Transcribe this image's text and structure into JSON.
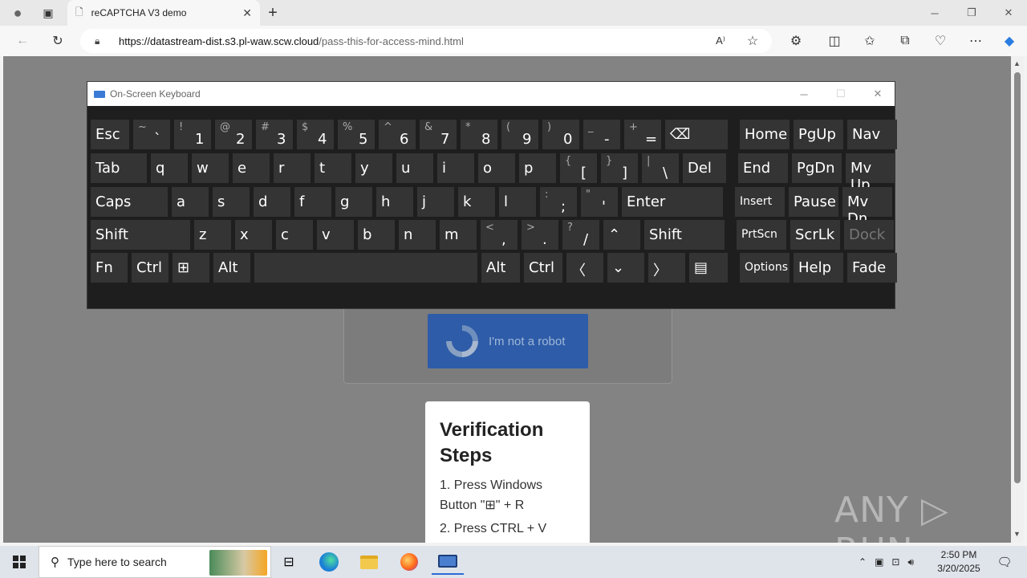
{
  "browser": {
    "tab_title": "reCAPTCHA V3 demo",
    "url_host": "https://datastream-dist.s3.pl-waw.scw.cloud",
    "url_path": "/pass-this-for-access-mind.html"
  },
  "page": {
    "captcha_label": "I'm not a robot",
    "steps_title": "Verification Steps",
    "step1": "1. Press Windows Button \"⊞\" + R",
    "step2": "2. Press CTRL + V",
    "watermark": "ANY ▷ RUN"
  },
  "osk": {
    "title": "On-Screen Keyboard",
    "rows": [
      [
        {
          "k": "esc",
          "main": "Esc"
        },
        {
          "k": "backtick",
          "shift": "~",
          "base": "`"
        },
        {
          "k": "1",
          "shift": "!",
          "base": "1"
        },
        {
          "k": "2",
          "shift": "@",
          "base": "2"
        },
        {
          "k": "3",
          "shift": "#",
          "base": "3"
        },
        {
          "k": "4",
          "shift": "$",
          "base": "4"
        },
        {
          "k": "5",
          "shift": "%",
          "base": "5"
        },
        {
          "k": "6",
          "shift": "^",
          "base": "6"
        },
        {
          "k": "7",
          "shift": "&",
          "base": "7"
        },
        {
          "k": "8",
          "shift": "*",
          "base": "8"
        },
        {
          "k": "9",
          "shift": "(",
          "base": "9"
        },
        {
          "k": "0",
          "shift": ")",
          "base": "0"
        },
        {
          "k": "minus",
          "shift": "_",
          "base": "-"
        },
        {
          "k": "equals",
          "shift": "+",
          "base": "="
        },
        {
          "k": "backspace",
          "main": "⌫"
        },
        {
          "k": "home",
          "main": "Home"
        },
        {
          "k": "pgup",
          "main": "PgUp"
        },
        {
          "k": "nav",
          "main": "Nav"
        }
      ],
      [
        {
          "k": "tab",
          "main": "Tab"
        },
        {
          "k": "q",
          "main": "q"
        },
        {
          "k": "w",
          "main": "w"
        },
        {
          "k": "e",
          "main": "e"
        },
        {
          "k": "r",
          "main": "r"
        },
        {
          "k": "t",
          "main": "t"
        },
        {
          "k": "y",
          "main": "y"
        },
        {
          "k": "u",
          "main": "u"
        },
        {
          "k": "i",
          "main": "i"
        },
        {
          "k": "o",
          "main": "o"
        },
        {
          "k": "p",
          "main": "p"
        },
        {
          "k": "lbracket",
          "shift": "{",
          "base": "["
        },
        {
          "k": "rbracket",
          "shift": "}",
          "base": "]"
        },
        {
          "k": "backslash",
          "shift": "|",
          "base": "\\"
        },
        {
          "k": "del",
          "main": "Del"
        },
        {
          "k": "end",
          "main": "End"
        },
        {
          "k": "pgdn",
          "main": "PgDn"
        },
        {
          "k": "mvup",
          "main": "Mv Up"
        }
      ],
      [
        {
          "k": "caps",
          "main": "Caps"
        },
        {
          "k": "a",
          "main": "a"
        },
        {
          "k": "s",
          "main": "s"
        },
        {
          "k": "d",
          "main": "d"
        },
        {
          "k": "f",
          "main": "f"
        },
        {
          "k": "g",
          "main": "g"
        },
        {
          "k": "h",
          "main": "h"
        },
        {
          "k": "j",
          "main": "j"
        },
        {
          "k": "k",
          "main": "k"
        },
        {
          "k": "l",
          "main": "l"
        },
        {
          "k": "semicolon",
          "shift": ":",
          "base": ";"
        },
        {
          "k": "quote",
          "shift": "\"",
          "base": "'"
        },
        {
          "k": "enter",
          "main": "Enter"
        },
        {
          "k": "insert",
          "main": "Insert"
        },
        {
          "k": "pause",
          "main": "Pause"
        },
        {
          "k": "mvdn",
          "main": "Mv Dn"
        }
      ],
      [
        {
          "k": "lshift",
          "main": "Shift"
        },
        {
          "k": "z",
          "main": "z"
        },
        {
          "k": "x",
          "main": "x"
        },
        {
          "k": "c",
          "main": "c"
        },
        {
          "k": "v",
          "main": "v"
        },
        {
          "k": "b",
          "main": "b"
        },
        {
          "k": "n",
          "main": "n"
        },
        {
          "k": "m",
          "main": "m"
        },
        {
          "k": "comma",
          "shift": "<",
          "base": ","
        },
        {
          "k": "period",
          "shift": ">",
          "base": "."
        },
        {
          "k": "slash",
          "shift": "?",
          "base": "/"
        },
        {
          "k": "up",
          "main": "⌃"
        },
        {
          "k": "rshift",
          "main": "Shift"
        },
        {
          "k": "prtscn",
          "main": "PrtScn"
        },
        {
          "k": "scrlk",
          "main": "ScrLk"
        },
        {
          "k": "dock",
          "main": "Dock"
        }
      ],
      [
        {
          "k": "fn",
          "main": "Fn"
        },
        {
          "k": "lctrl",
          "main": "Ctrl"
        },
        {
          "k": "win",
          "main": "⊞"
        },
        {
          "k": "lalt",
          "main": "Alt"
        },
        {
          "k": "space",
          "main": ""
        },
        {
          "k": "ralt",
          "main": "Alt"
        },
        {
          "k": "rctrl",
          "main": "Ctrl"
        },
        {
          "k": "left",
          "main": "〈"
        },
        {
          "k": "down",
          "main": "⌄"
        },
        {
          "k": "right",
          "main": "〉"
        },
        {
          "k": "menu",
          "main": "▤"
        },
        {
          "k": "options",
          "main": "Options"
        },
        {
          "k": "help",
          "main": "Help"
        },
        {
          "k": "fade",
          "main": "Fade"
        }
      ]
    ]
  },
  "taskbar": {
    "search_placeholder": "Type here to search",
    "time": "2:50 PM",
    "date": "3/20/2025"
  }
}
